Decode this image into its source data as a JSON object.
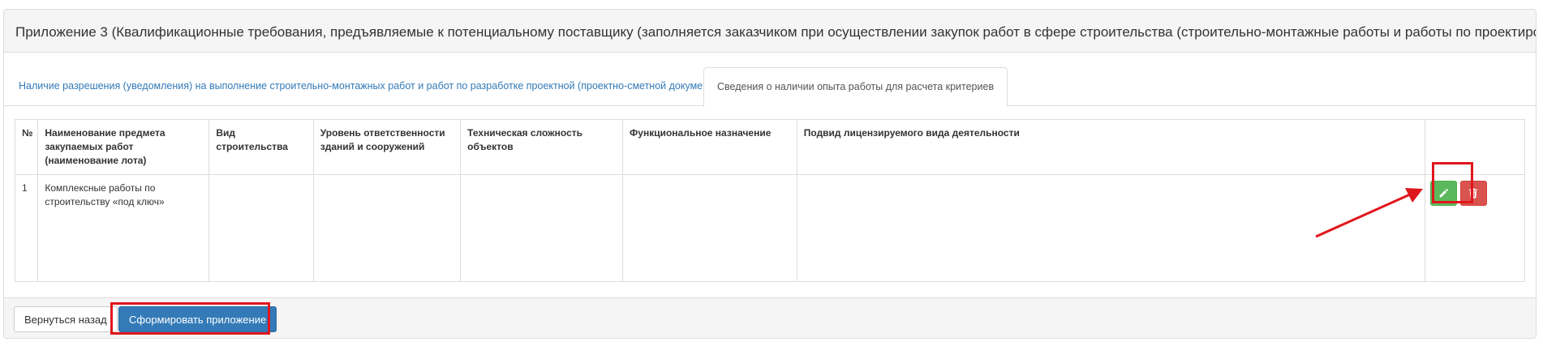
{
  "header": {
    "title": "Приложение 3 (Квалификационные требования, предъявляемые к потенциальному поставщику (заполняется заказчиком при осуществлении закупок работ в сфере строительства (строительно-монтажные работы и работы по проектированию)"
  },
  "tabs": [
    {
      "label": "Наличие разрешения (уведомления) на выполнение строительно-монтажных работ и работ по разработке проектной (проектно-сметной документации)",
      "active": false
    },
    {
      "label": "Сведения о наличии опыта работы для расчета критериев",
      "active": true
    }
  ],
  "table": {
    "headers": [
      "№",
      "Наименование предмета закупаемых работ (наименование лота)",
      "Вид строительства",
      "Уровень ответственности зданий и сооружений",
      "Техническая сложность объектов",
      "Функциональное назначение",
      "Подвид лицензируемого вида деятельности",
      ""
    ],
    "rows": [
      {
        "num": "1",
        "name": "Комплексные работы по строительству «под ключ»",
        "construction_type": "",
        "responsibility_level": "",
        "technical_complexity": "",
        "functional_purpose": "",
        "license_subtype": ""
      }
    ]
  },
  "icons": {
    "edit": "pencil-icon",
    "delete": "trash-icon"
  },
  "footer": {
    "back_label": "Вернуться назад",
    "generate_label": "Сформировать приложение"
  },
  "colors": {
    "primary": "#337ab7",
    "success": "#5cb85c",
    "danger": "#d9534f",
    "highlight": "#e0161d"
  }
}
